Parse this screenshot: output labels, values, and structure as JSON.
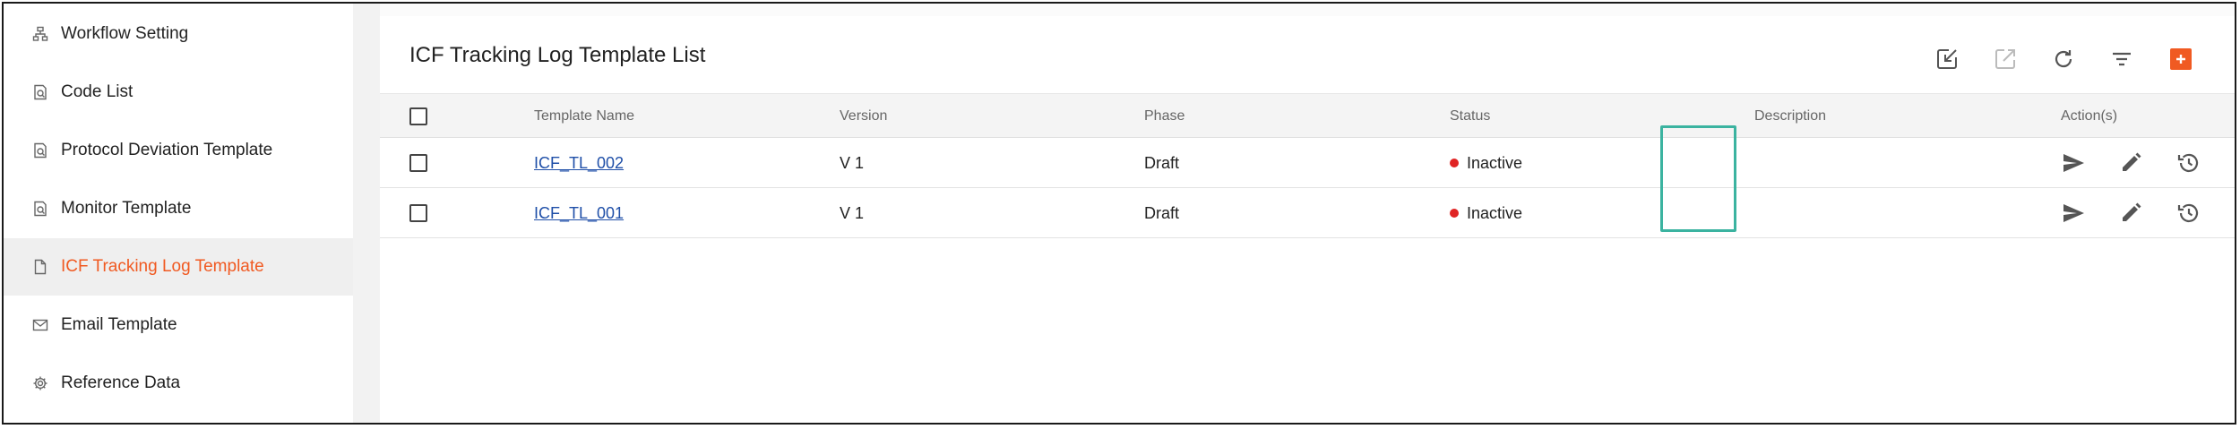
{
  "sidebar": {
    "items": [
      {
        "label": "Workflow Setting",
        "icon": "workflow-icon",
        "active": false
      },
      {
        "label": "Code List",
        "icon": "code-list-icon",
        "active": false
      },
      {
        "label": "Protocol Deviation Template",
        "icon": "document-search-icon",
        "active": false
      },
      {
        "label": "Monitor Template",
        "icon": "document-search-icon",
        "active": false
      },
      {
        "label": "ICF Tracking Log Template",
        "icon": "document-icon",
        "active": true
      },
      {
        "label": "Email Template",
        "icon": "mail-icon",
        "active": false
      },
      {
        "label": "Reference Data",
        "icon": "gear-icon",
        "active": false
      }
    ]
  },
  "main": {
    "title": "ICF Tracking Log Template List",
    "toolbar": [
      "import-icon",
      "export-icon",
      "refresh-icon",
      "filter-icon",
      "add-icon"
    ]
  },
  "table": {
    "headers": {
      "name": "Template Name",
      "version": "Version",
      "phase": "Phase",
      "status": "Status",
      "description": "Description",
      "actions": "Action(s)"
    },
    "rows": [
      {
        "name": "ICF_TL_002",
        "version": "V 1",
        "phase": "Draft",
        "status": "Inactive",
        "description": ""
      },
      {
        "name": "ICF_TL_001",
        "version": "V 1",
        "phase": "Draft",
        "status": "Inactive",
        "description": ""
      }
    ]
  },
  "colors": {
    "accent": "#f05a22",
    "link": "#1f4fa8",
    "status_inactive": "#e02424",
    "highlight": "#3bb3a0"
  }
}
